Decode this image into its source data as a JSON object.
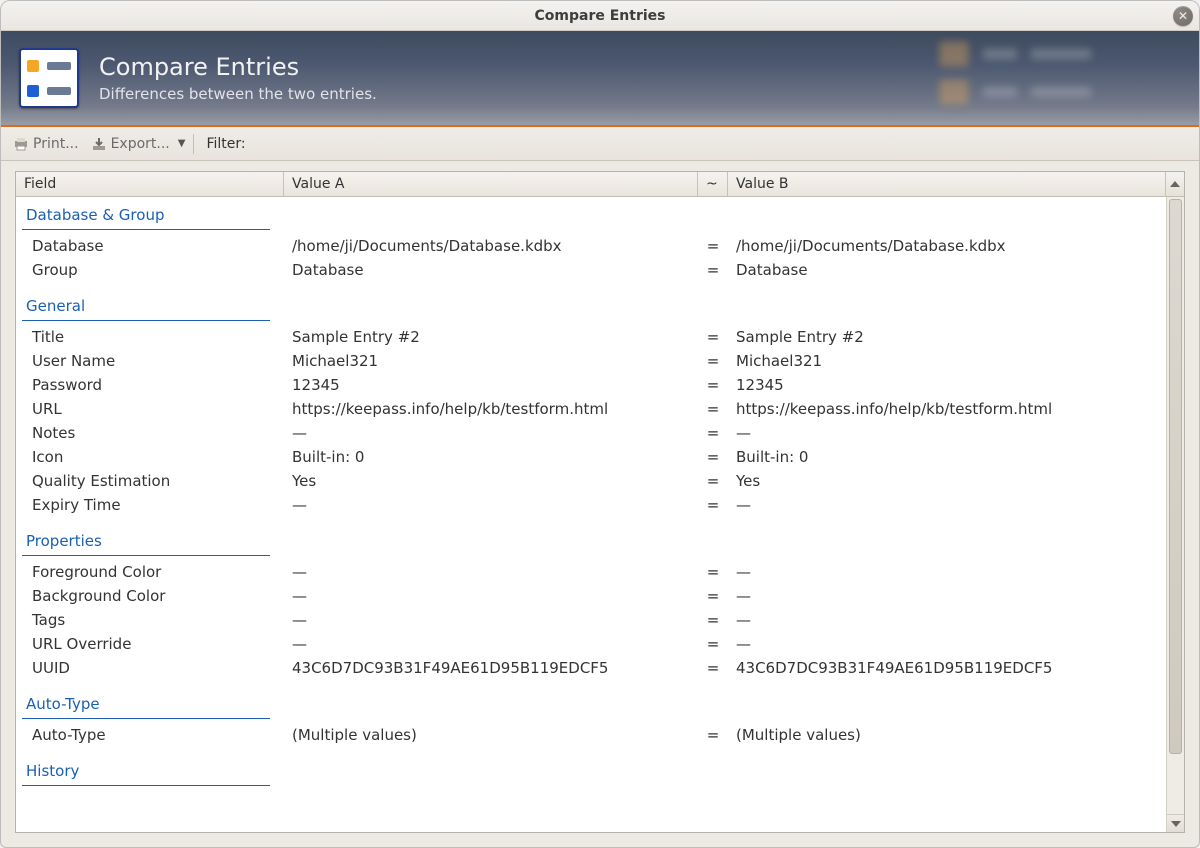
{
  "window": {
    "title": "Compare Entries"
  },
  "banner": {
    "title": "Compare Entries",
    "subtitle": "Differences between the two entries."
  },
  "toolbar": {
    "print_label": "Print...",
    "export_label": "Export...",
    "filter_label": "Filter:"
  },
  "columns": {
    "field": "Field",
    "value_a": "Value A",
    "op": "~",
    "value_b": "Value B"
  },
  "sections": [
    {
      "title": "Database & Group",
      "rows": [
        {
          "field": "Database",
          "a": "/home/ji/Documents/Database.kdbx",
          "op": "=",
          "b": "/home/ji/Documents/Database.kdbx"
        },
        {
          "field": "Group",
          "a": "Database",
          "op": "=",
          "b": "Database"
        }
      ]
    },
    {
      "title": "General",
      "rows": [
        {
          "field": "Title",
          "a": "Sample Entry #2",
          "op": "=",
          "b": "Sample Entry #2"
        },
        {
          "field": "User Name",
          "a": "Michael321",
          "op": "=",
          "b": "Michael321"
        },
        {
          "field": "Password",
          "a": "12345",
          "op": "=",
          "b": "12345"
        },
        {
          "field": "URL",
          "a": "https://keepass.info/help/kb/testform.html",
          "op": "=",
          "b": "https://keepass.info/help/kb/testform.html"
        },
        {
          "field": "Notes",
          "a": "—",
          "op": "=",
          "b": "—"
        },
        {
          "field": "Icon",
          "a": "Built-in: 0",
          "op": "=",
          "b": "Built-in: 0"
        },
        {
          "field": "Quality Estimation",
          "a": "Yes",
          "op": "=",
          "b": "Yes"
        },
        {
          "field": "Expiry Time",
          "a": "—",
          "op": "=",
          "b": "—"
        }
      ]
    },
    {
      "title": "Properties",
      "rows": [
        {
          "field": "Foreground Color",
          "a": "—",
          "op": "=",
          "b": "—"
        },
        {
          "field": "Background Color",
          "a": "—",
          "op": "=",
          "b": "—"
        },
        {
          "field": "Tags",
          "a": "—",
          "op": "=",
          "b": "—"
        },
        {
          "field": "URL Override",
          "a": "—",
          "op": "=",
          "b": "—"
        },
        {
          "field": "UUID",
          "a": "43C6D7DC93B31F49AE61D95B119EDCF5",
          "op": "=",
          "b": "43C6D7DC93B31F49AE61D95B119EDCF5"
        }
      ]
    },
    {
      "title": "Auto-Type",
      "rows": [
        {
          "field": "Auto-Type",
          "a": "(Multiple values)",
          "op": "=",
          "b": "(Multiple values)"
        }
      ]
    },
    {
      "title": "History",
      "rows": []
    }
  ]
}
